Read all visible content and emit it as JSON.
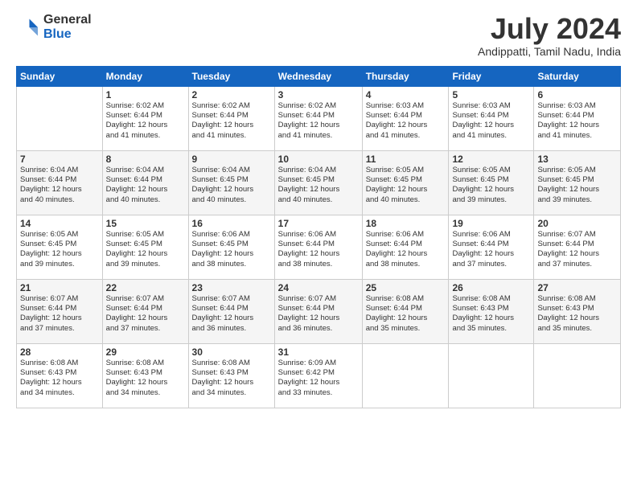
{
  "logo": {
    "general": "General",
    "blue": "Blue"
  },
  "title": {
    "month": "July 2024",
    "location": "Andippatti, Tamil Nadu, India"
  },
  "calendar": {
    "headers": [
      "Sunday",
      "Monday",
      "Tuesday",
      "Wednesday",
      "Thursday",
      "Friday",
      "Saturday"
    ],
    "weeks": [
      [
        {
          "day": "",
          "info": ""
        },
        {
          "day": "1",
          "info": "Sunrise: 6:02 AM\nSunset: 6:44 PM\nDaylight: 12 hours\nand 41 minutes."
        },
        {
          "day": "2",
          "info": "Sunrise: 6:02 AM\nSunset: 6:44 PM\nDaylight: 12 hours\nand 41 minutes."
        },
        {
          "day": "3",
          "info": "Sunrise: 6:02 AM\nSunset: 6:44 PM\nDaylight: 12 hours\nand 41 minutes."
        },
        {
          "day": "4",
          "info": "Sunrise: 6:03 AM\nSunset: 6:44 PM\nDaylight: 12 hours\nand 41 minutes."
        },
        {
          "day": "5",
          "info": "Sunrise: 6:03 AM\nSunset: 6:44 PM\nDaylight: 12 hours\nand 41 minutes."
        },
        {
          "day": "6",
          "info": "Sunrise: 6:03 AM\nSunset: 6:44 PM\nDaylight: 12 hours\nand 41 minutes."
        }
      ],
      [
        {
          "day": "7",
          "info": "Sunrise: 6:04 AM\nSunset: 6:44 PM\nDaylight: 12 hours\nand 40 minutes."
        },
        {
          "day": "8",
          "info": "Sunrise: 6:04 AM\nSunset: 6:44 PM\nDaylight: 12 hours\nand 40 minutes."
        },
        {
          "day": "9",
          "info": "Sunrise: 6:04 AM\nSunset: 6:45 PM\nDaylight: 12 hours\nand 40 minutes."
        },
        {
          "day": "10",
          "info": "Sunrise: 6:04 AM\nSunset: 6:45 PM\nDaylight: 12 hours\nand 40 minutes."
        },
        {
          "day": "11",
          "info": "Sunrise: 6:05 AM\nSunset: 6:45 PM\nDaylight: 12 hours\nand 40 minutes."
        },
        {
          "day": "12",
          "info": "Sunrise: 6:05 AM\nSunset: 6:45 PM\nDaylight: 12 hours\nand 39 minutes."
        },
        {
          "day": "13",
          "info": "Sunrise: 6:05 AM\nSunset: 6:45 PM\nDaylight: 12 hours\nand 39 minutes."
        }
      ],
      [
        {
          "day": "14",
          "info": "Sunrise: 6:05 AM\nSunset: 6:45 PM\nDaylight: 12 hours\nand 39 minutes."
        },
        {
          "day": "15",
          "info": "Sunrise: 6:05 AM\nSunset: 6:45 PM\nDaylight: 12 hours\nand 39 minutes."
        },
        {
          "day": "16",
          "info": "Sunrise: 6:06 AM\nSunset: 6:45 PM\nDaylight: 12 hours\nand 38 minutes."
        },
        {
          "day": "17",
          "info": "Sunrise: 6:06 AM\nSunset: 6:44 PM\nDaylight: 12 hours\nand 38 minutes."
        },
        {
          "day": "18",
          "info": "Sunrise: 6:06 AM\nSunset: 6:44 PM\nDaylight: 12 hours\nand 38 minutes."
        },
        {
          "day": "19",
          "info": "Sunrise: 6:06 AM\nSunset: 6:44 PM\nDaylight: 12 hours\nand 37 minutes."
        },
        {
          "day": "20",
          "info": "Sunrise: 6:07 AM\nSunset: 6:44 PM\nDaylight: 12 hours\nand 37 minutes."
        }
      ],
      [
        {
          "day": "21",
          "info": "Sunrise: 6:07 AM\nSunset: 6:44 PM\nDaylight: 12 hours\nand 37 minutes."
        },
        {
          "day": "22",
          "info": "Sunrise: 6:07 AM\nSunset: 6:44 PM\nDaylight: 12 hours\nand 37 minutes."
        },
        {
          "day": "23",
          "info": "Sunrise: 6:07 AM\nSunset: 6:44 PM\nDaylight: 12 hours\nand 36 minutes."
        },
        {
          "day": "24",
          "info": "Sunrise: 6:07 AM\nSunset: 6:44 PM\nDaylight: 12 hours\nand 36 minutes."
        },
        {
          "day": "25",
          "info": "Sunrise: 6:08 AM\nSunset: 6:44 PM\nDaylight: 12 hours\nand 35 minutes."
        },
        {
          "day": "26",
          "info": "Sunrise: 6:08 AM\nSunset: 6:43 PM\nDaylight: 12 hours\nand 35 minutes."
        },
        {
          "day": "27",
          "info": "Sunrise: 6:08 AM\nSunset: 6:43 PM\nDaylight: 12 hours\nand 35 minutes."
        }
      ],
      [
        {
          "day": "28",
          "info": "Sunrise: 6:08 AM\nSunset: 6:43 PM\nDaylight: 12 hours\nand 34 minutes."
        },
        {
          "day": "29",
          "info": "Sunrise: 6:08 AM\nSunset: 6:43 PM\nDaylight: 12 hours\nand 34 minutes."
        },
        {
          "day": "30",
          "info": "Sunrise: 6:08 AM\nSunset: 6:43 PM\nDaylight: 12 hours\nand 34 minutes."
        },
        {
          "day": "31",
          "info": "Sunrise: 6:09 AM\nSunset: 6:42 PM\nDaylight: 12 hours\nand 33 minutes."
        },
        {
          "day": "",
          "info": ""
        },
        {
          "day": "",
          "info": ""
        },
        {
          "day": "",
          "info": ""
        }
      ]
    ]
  }
}
